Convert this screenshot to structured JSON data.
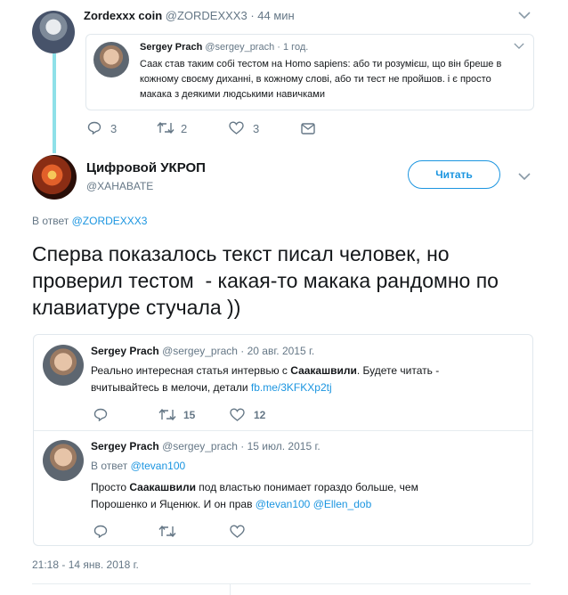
{
  "top_tweet": {
    "author_name": "Zordexxx coin",
    "author_handle": "@ZORDEXXX3",
    "time": "· 44 мин",
    "quoted": {
      "author_name": "Sergey Prach",
      "author_handle": "@sergey_prach",
      "time": "· 1 год.",
      "text": "Саак став таким собі тестом на Homo sapiens: або ти розумієш, що він бреше в кожному своєму диханні, в кожному слові, або ти тест не пройшов. і є просто макака з деякими людськими навичками"
    },
    "actions": {
      "reply_count": "3",
      "retweet_count": "2",
      "like_count": "3"
    }
  },
  "main_tweet": {
    "author_name": "Цифровой УКРОП",
    "author_handle": "@XAHABATE",
    "follow_label": "Читать",
    "reply_prefix": "В ответ",
    "reply_to": "@ZORDEXXX3",
    "text": "Сперва показалось текст писал человек, но проверил тестом  - какая-то макака рандомно по клавиатуре стучала ))",
    "timestamp": "21:18 - 14 янв. 2018 г."
  },
  "thread": [
    {
      "author_name": "Sergey Prach",
      "author_handle": "@sergey_prach",
      "time": "· 20 авг. 2015 г.",
      "text_before": "Реально интересная статья интервью с ",
      "text_bold": "Саакашвили",
      "text_after": ". Будете читать - вчитывайтесь в мелочи, детали ",
      "link": "fb.me/3KFKXp2tj",
      "retweet_count": "15",
      "like_count": "12"
    },
    {
      "author_name": "Sergey Prach",
      "author_handle": "@sergey_prach",
      "time": "· 15 июл. 2015 г.",
      "reply_prefix": "В ответ",
      "reply_to": "@tevan100",
      "text_before": "Просто ",
      "text_bold": "Саакашвили",
      "text_after": " под властью понимает гораздо больше, чем Порошенко и Яценюк. И он прав ",
      "mention1": "@tevan100",
      "mention2": "@Ellen_dob"
    }
  ],
  "colors": {
    "link": "#1b95e0",
    "muted": "#657786",
    "border": "#e1e8ed",
    "thread_line": "#8ee0e8"
  },
  "icons": [
    "chevron-down-icon",
    "reply-icon",
    "retweet-icon",
    "like-icon",
    "dm-icon"
  ]
}
